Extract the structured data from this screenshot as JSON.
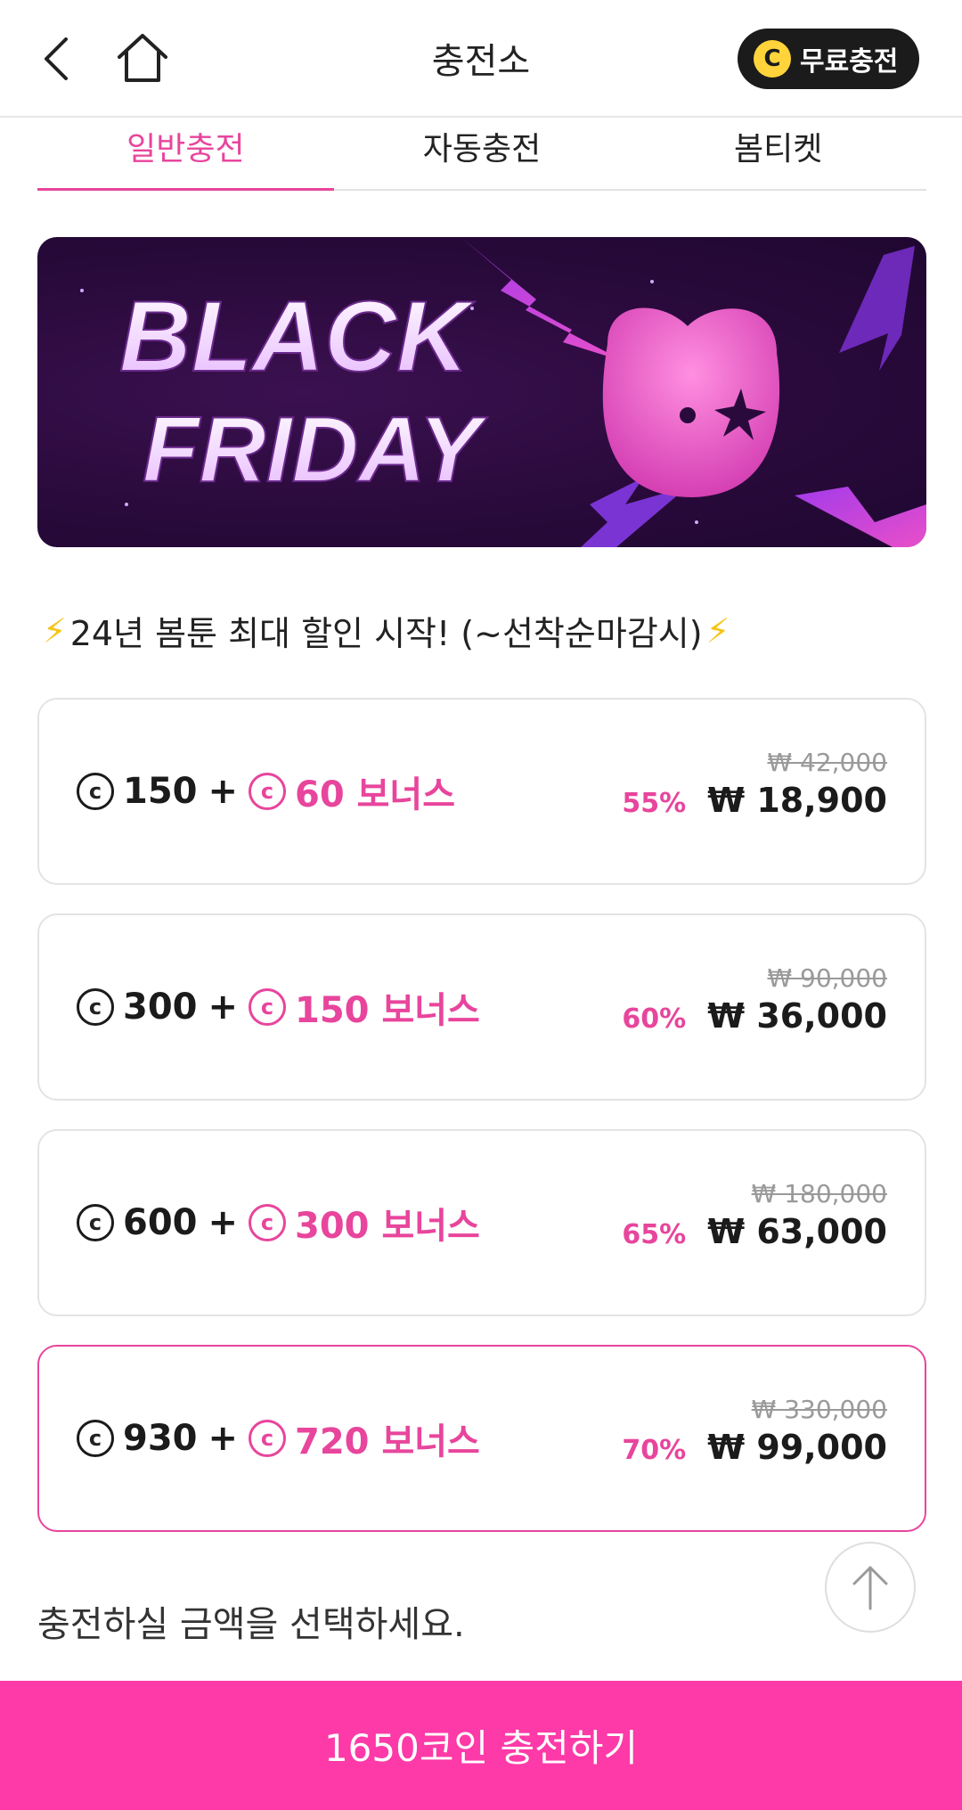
{
  "header": {
    "title": "충전소",
    "free_charge": {
      "coin_symbol": "C",
      "label": "무료충전"
    }
  },
  "tabs": [
    {
      "label": "일반충전",
      "active": true
    },
    {
      "label": "자동충전",
      "active": false
    },
    {
      "label": "봄티켓",
      "active": false
    }
  ],
  "banner": {
    "line1": "BLACK",
    "line2": "FRIDAY"
  },
  "promo": {
    "text": "24년 봄툰 최대 할인 시작! (~선착순마감시)"
  },
  "coin_symbol": "c",
  "packages": [
    {
      "base": "150",
      "plus": "+",
      "bonus": "60 보너스",
      "original": "₩ 42,000",
      "discount": "55%",
      "price": "₩ 18,900",
      "selected": false
    },
    {
      "base": "300",
      "plus": "+",
      "bonus": "150 보너스",
      "original": "₩ 90,000",
      "discount": "60%",
      "price": "₩ 36,000",
      "selected": false
    },
    {
      "base": "600",
      "plus": "+",
      "bonus": "300 보너스",
      "original": "₩ 180,000",
      "discount": "65%",
      "price": "₩ 63,000",
      "selected": false
    },
    {
      "base": "930",
      "plus": "+",
      "bonus": "720 보너스",
      "original": "₩ 330,000",
      "discount": "70%",
      "price": "₩ 99,000",
      "selected": true
    }
  ],
  "footer": {
    "instruction": "충전하실 금액을 선택하세요.",
    "cta_label": "1650코인 충전하기"
  },
  "colors": {
    "accent": "#e8459c",
    "cta": "#fd3aa8",
    "banner_bg": "#2a0a3c",
    "coin_yellow": "#ffd43b"
  }
}
